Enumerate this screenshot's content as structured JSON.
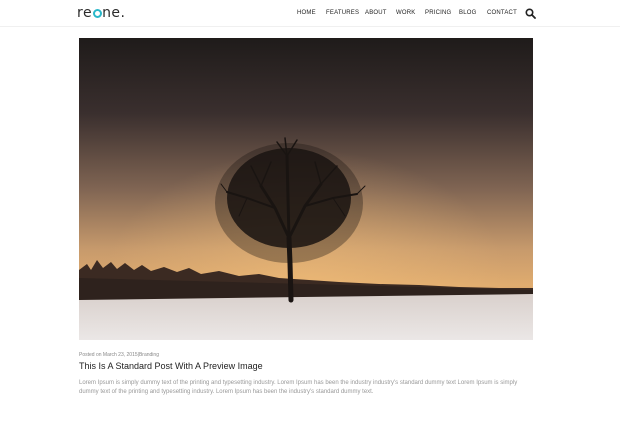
{
  "brand": {
    "logo_prefix": "re",
    "logo_suffix": "ne.",
    "accent_color": "#2ab7c9"
  },
  "nav": {
    "items": [
      {
        "label": "HOME"
      },
      {
        "label": "FEATURES"
      },
      {
        "label": "ABOUT"
      },
      {
        "label": "WORK"
      },
      {
        "label": "PRICING"
      },
      {
        "label": "BLOG"
      },
      {
        "label": "CONTACT"
      }
    ],
    "search_icon": "search-icon"
  },
  "post": {
    "meta_posted": "Posted on March 23, 2015",
    "meta_separator": "|",
    "meta_category": "Branding",
    "title": "This Is A Standard Post With A Preview Image",
    "excerpt": "Lorem Ipsum is simply dummy text of the printing and typesetting industry. Lorem Ipsum has been the industry industry's standard dummy text Lorem Ipsum is simply dummy text of the printing and typesetting industry. Lorem Ipsum has been the industry's standard dummy text."
  }
}
